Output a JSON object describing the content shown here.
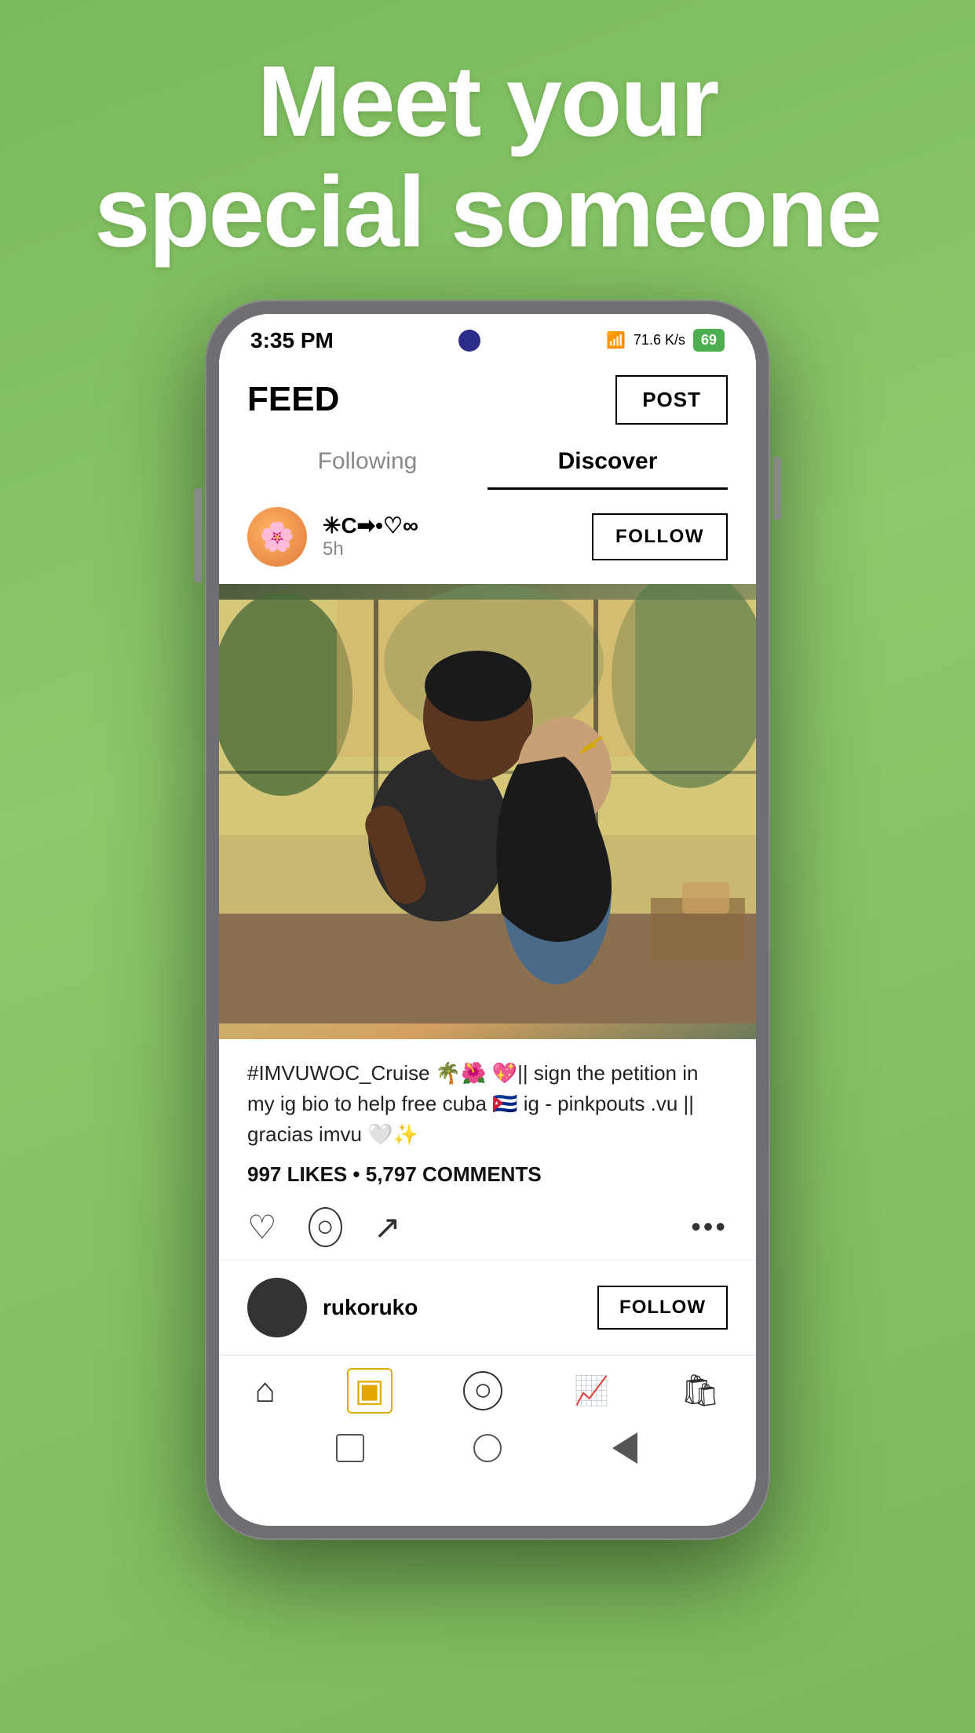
{
  "hero": {
    "line1": "Meet your",
    "line2": "special someone"
  },
  "status_bar": {
    "time": "3:35 PM",
    "signal": "71.6 K/s",
    "battery": "69"
  },
  "header": {
    "title": "FEED",
    "post_button": "POST"
  },
  "tabs": [
    {
      "label": "Following",
      "active": false
    },
    {
      "label": "Discover",
      "active": true
    }
  ],
  "post": {
    "username": "✳C➡•♡∞",
    "time": "5h",
    "follow_label": "FOLLOW",
    "caption": "#IMVUWOC_Cruise 🌴🌺 💖|| sign the petition in my ig bio to help free cuba 🇨🇺 ig - pinkpouts .vu || gracias imvu 🤍✨",
    "likes": "997 LIKES",
    "comments": "5,797 COMMENTS"
  },
  "actions": {
    "like_icon": "♡",
    "comment_icon": "◯",
    "share_icon": "↗",
    "more_icon": "•••"
  },
  "next_post": {
    "username": "rukoruko"
  },
  "bottom_nav": {
    "items": [
      {
        "icon": "⌂",
        "name": "home"
      },
      {
        "icon": "▣",
        "name": "feed",
        "active": true
      },
      {
        "icon": "◯",
        "name": "chat"
      },
      {
        "icon": "📈",
        "name": "trending"
      },
      {
        "icon": "🛍",
        "name": "shop"
      }
    ]
  }
}
